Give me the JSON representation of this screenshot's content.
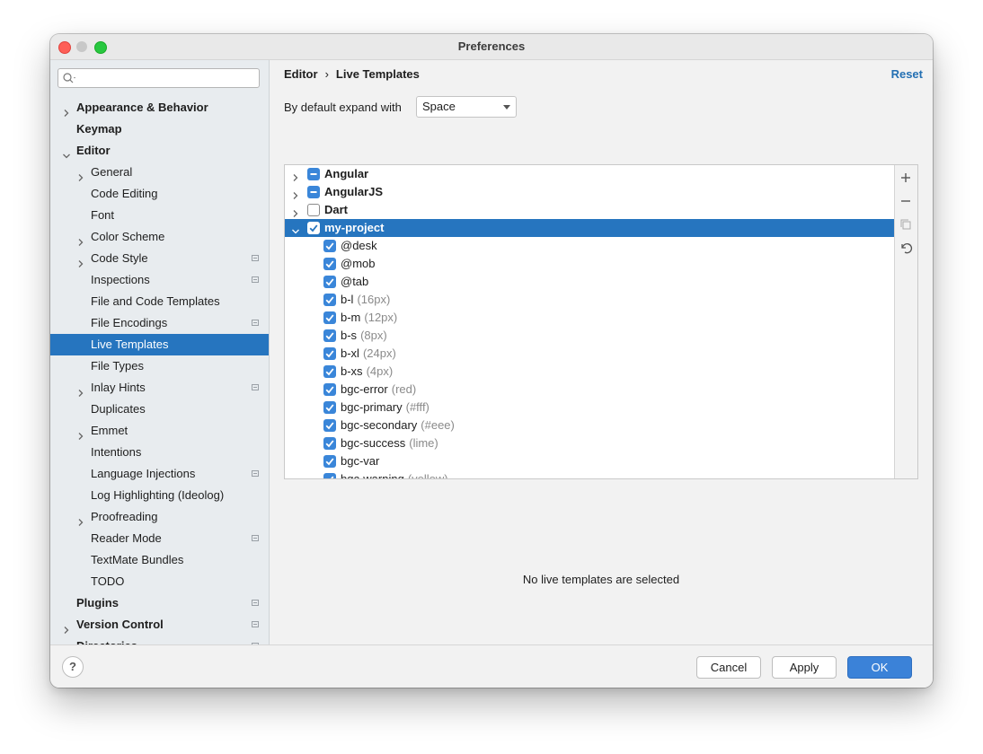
{
  "window": {
    "title": "Preferences"
  },
  "sidebar": {
    "search_placeholder": "",
    "items": [
      {
        "label": "Appearance & Behavior",
        "bold": true,
        "arrow": "right",
        "indent": 0
      },
      {
        "label": "Keymap",
        "bold": true,
        "arrow": null,
        "indent": 0
      },
      {
        "label": "Editor",
        "bold": true,
        "arrow": "down",
        "indent": 0
      },
      {
        "label": "General",
        "arrow": "right",
        "indent": 1
      },
      {
        "label": "Code Editing",
        "indent": 1
      },
      {
        "label": "Font",
        "indent": 1
      },
      {
        "label": "Color Scheme",
        "arrow": "right",
        "indent": 1
      },
      {
        "label": "Code Style",
        "arrow": "right",
        "indent": 1,
        "project": true
      },
      {
        "label": "Inspections",
        "indent": 1,
        "project": true
      },
      {
        "label": "File and Code Templates",
        "indent": 1
      },
      {
        "label": "File Encodings",
        "indent": 1,
        "project": true
      },
      {
        "label": "Live Templates",
        "indent": 1,
        "selected": true
      },
      {
        "label": "File Types",
        "indent": 1
      },
      {
        "label": "Inlay Hints",
        "arrow": "right",
        "indent": 1,
        "project": true
      },
      {
        "label": "Duplicates",
        "indent": 1
      },
      {
        "label": "Emmet",
        "arrow": "right",
        "indent": 1
      },
      {
        "label": "Intentions",
        "indent": 1
      },
      {
        "label": "Language Injections",
        "indent": 1,
        "project": true
      },
      {
        "label": "Log Highlighting (Ideolog)",
        "indent": 1
      },
      {
        "label": "Proofreading",
        "arrow": "right",
        "indent": 1
      },
      {
        "label": "Reader Mode",
        "indent": 1,
        "project": true
      },
      {
        "label": "TextMate Bundles",
        "indent": 1
      },
      {
        "label": "TODO",
        "indent": 1
      },
      {
        "label": "Plugins",
        "bold": true,
        "indent": 0,
        "project": true
      },
      {
        "label": "Version Control",
        "bold": true,
        "arrow": "right",
        "indent": 0,
        "project": true
      },
      {
        "label": "Directories",
        "bold": true,
        "indent": 0,
        "project": true
      }
    ]
  },
  "content": {
    "breadcrumb": [
      "Editor",
      "Live Templates"
    ],
    "breadcrumb_sep": "›",
    "reset_label": "Reset",
    "expand_label": "By default expand with",
    "expand_value": "Space",
    "empty_message": "No live templates are selected",
    "tree": [
      {
        "name": "Angular",
        "group": true,
        "state": "partial",
        "expanded": false
      },
      {
        "name": "AngularJS",
        "group": true,
        "state": "partial",
        "expanded": false
      },
      {
        "name": "Dart",
        "group": true,
        "state": "off",
        "expanded": false
      },
      {
        "name": "my-project",
        "group": true,
        "state": "on",
        "expanded": true,
        "selected": true
      },
      {
        "name": "@desk",
        "desc": "",
        "state": "on"
      },
      {
        "name": "@mob",
        "desc": "",
        "state": "on"
      },
      {
        "name": "@tab",
        "desc": "",
        "state": "on"
      },
      {
        "name": "b-l",
        "desc": "(16px)",
        "state": "on"
      },
      {
        "name": "b-m",
        "desc": "(12px)",
        "state": "on"
      },
      {
        "name": "b-s",
        "desc": "(8px)",
        "state": "on"
      },
      {
        "name": "b-xl",
        "desc": "(24px)",
        "state": "on"
      },
      {
        "name": "b-xs",
        "desc": "(4px)",
        "state": "on"
      },
      {
        "name": "bgc-error",
        "desc": "(red)",
        "state": "on"
      },
      {
        "name": "bgc-primary",
        "desc": "(#fff)",
        "state": "on"
      },
      {
        "name": "bgc-secondary",
        "desc": "(#eee)",
        "state": "on"
      },
      {
        "name": "bgc-success",
        "desc": "(lime)",
        "state": "on"
      },
      {
        "name": "bgc-var",
        "desc": "",
        "state": "on"
      },
      {
        "name": "bgc-warning",
        "desc": "(yellow)",
        "state": "on"
      }
    ],
    "toolbar_icons": [
      "add-icon",
      "remove-icon",
      "copy-icon",
      "restore-icon"
    ]
  },
  "footer": {
    "help_label": "?",
    "cancel_label": "Cancel",
    "apply_label": "Apply",
    "ok_label": "OK"
  },
  "colors": {
    "selection": "#2675bf",
    "accent": "#3b82d8",
    "link": "#2470b3"
  }
}
